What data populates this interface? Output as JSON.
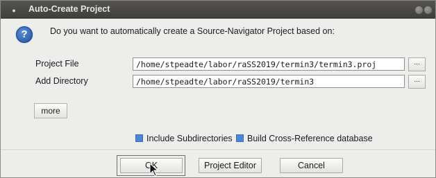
{
  "window": {
    "title": "Auto-Create Project",
    "title_icon": "window-menu-icon",
    "controls": [
      "minimize-icon",
      "close-icon"
    ]
  },
  "dialog": {
    "icon": "question-icon",
    "prompt": "Do you want to automatically create a Source-Navigator Project based on:"
  },
  "fields": {
    "project_file": {
      "label": "Project File",
      "value": "/home/stpeadte/labor/raSS2019/termin3/termin3.proj",
      "browse_label": "..."
    },
    "add_directory": {
      "label": "Add Directory",
      "value": "/home/stpeadte/labor/raSS2019/termin3",
      "browse_label": "..."
    }
  },
  "more_button": {
    "label": "more"
  },
  "options": [
    {
      "label": "Include Subdirectories",
      "checked": true
    },
    {
      "label": "Build Cross-Reference database",
      "checked": true
    }
  ],
  "buttons": {
    "ok": "OK",
    "project_editor": "Project Editor",
    "cancel": "Cancel"
  },
  "colors": {
    "titlebar": "#4a4844",
    "checkbox_accent": "#4a86d8",
    "window_bg": "#ededec"
  }
}
